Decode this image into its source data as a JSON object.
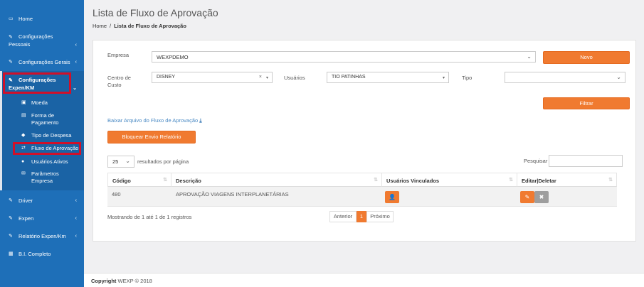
{
  "sidebar": {
    "home": "Home",
    "config_pessoais": "Configurações Pessoais",
    "config_gerais": "Configurações Gerais",
    "config_expen": "Configurações Expen/KM",
    "moeda": "Moeda",
    "forma_pagamento": "Forma de Pagamento",
    "tipo_despesa": "Tipo de Despesa",
    "fluxo_aprovacao": "Fluxo de Aprovação",
    "usuarios_ativos": "Usuários Ativos",
    "parametros_empresa": "Parâmetros Empresa",
    "driver": "Driver",
    "expen": "Expen",
    "relatorio": "Relatório Expen/Km",
    "bi": "B.I. Completo"
  },
  "header": {
    "title": "Lista de Fluxo de Aprovação",
    "breadcrumb_home": "Home",
    "breadcrumb_sep": "/",
    "breadcrumb_current": "Lista de Fluxo de Aprovação"
  },
  "form": {
    "empresa_label": "Empresa",
    "empresa_value": "WEXPDEMO",
    "novo_button": "Novo",
    "centro_custo_label": "Centro de Custo",
    "centro_custo_value": "DISNEY",
    "usuarios_label": "Usuários",
    "usuarios_value": "TIO PATINHAS",
    "tipo_label": "Tipo",
    "tipo_value": "",
    "filtrar_button": "Filtrar",
    "download_link": "Baixar Arquivo do Fluxo de Aprovação",
    "bloquear_button": "Bloquear Envio Relatório"
  },
  "table_controls": {
    "page_size": "25",
    "page_size_label": "resultados por página",
    "search_label": "Pesquisar",
    "search_value": ""
  },
  "table": {
    "headers": [
      "Código",
      "Descrição",
      "Usuários Vinculados",
      "Editar|Deletar"
    ],
    "rows": [
      {
        "codigo": "480",
        "descricao": "APROVAÇÃO VIAGENS INTERPLANETÁRIAS"
      }
    ]
  },
  "pagination": {
    "info": "Mostrando de 1 até 1 de 1 registros",
    "prev": "Anterior",
    "current": "1",
    "next": "Próximo"
  },
  "footer": {
    "copyright_label": "Copyright",
    "copyright_text": "WEXP © 2018"
  },
  "colors": {
    "sidebar": "#1e6fb8",
    "accent": "#f07a30",
    "highlight": "#d0102a",
    "delete_button": "#9e9e9e"
  }
}
